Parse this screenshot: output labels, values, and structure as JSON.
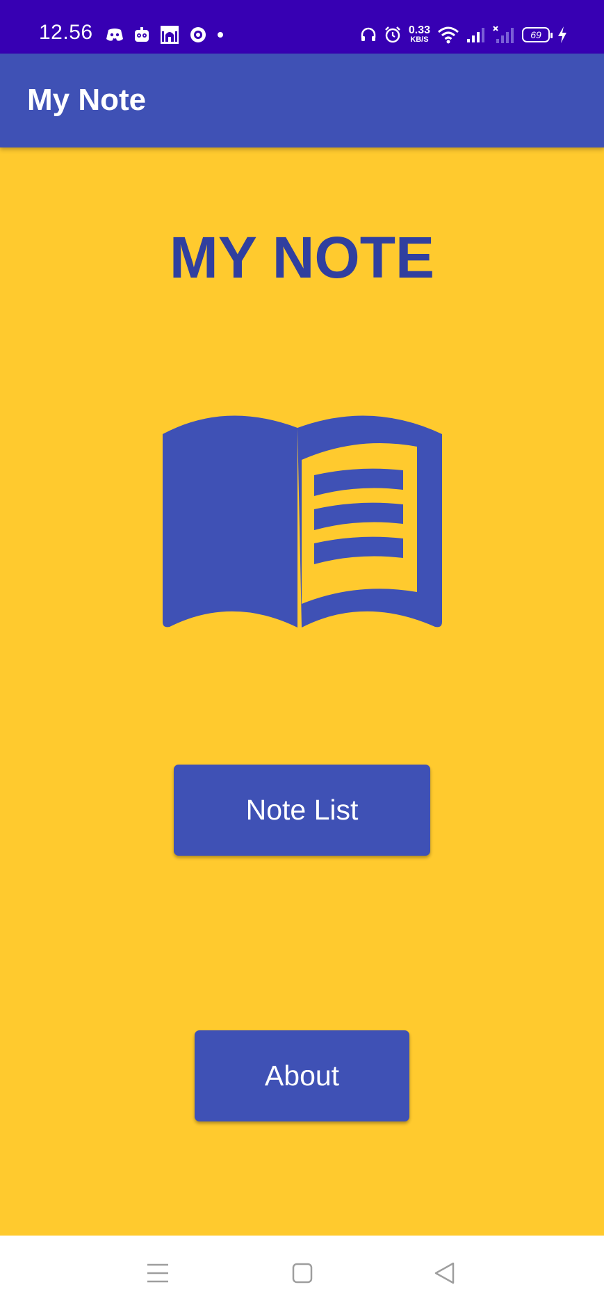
{
  "status_bar": {
    "time": "12.56",
    "left_icons": [
      "discord-icon",
      "robot-face-icon",
      "mosque-icon",
      "location-target-icon",
      "notification-dot-icon"
    ],
    "right_icons": [
      "headphones-icon",
      "alarm-icon",
      "wifi-icon",
      "signal-icon",
      "signal-no-service-icon",
      "battery-icon",
      "charging-bolt-icon"
    ],
    "net_speed_value": "0.33",
    "net_speed_unit": "KB/S",
    "battery_level": "69"
  },
  "app_bar": {
    "title": "My Note"
  },
  "main": {
    "headline": "MY NOTE",
    "illustration": "open-book-icon",
    "buttons": {
      "note_list": "Note List",
      "about": "About"
    }
  },
  "nav_bar": {
    "items": [
      "menu-icon",
      "home-square-icon",
      "back-triangle-icon"
    ]
  },
  "colors": {
    "status_bar": "#3700B3",
    "primary": "#3F51B5",
    "primary_dark_text": "#303F9F",
    "background": "#FFCA2E",
    "nav_bar": "#FFFFFF"
  }
}
